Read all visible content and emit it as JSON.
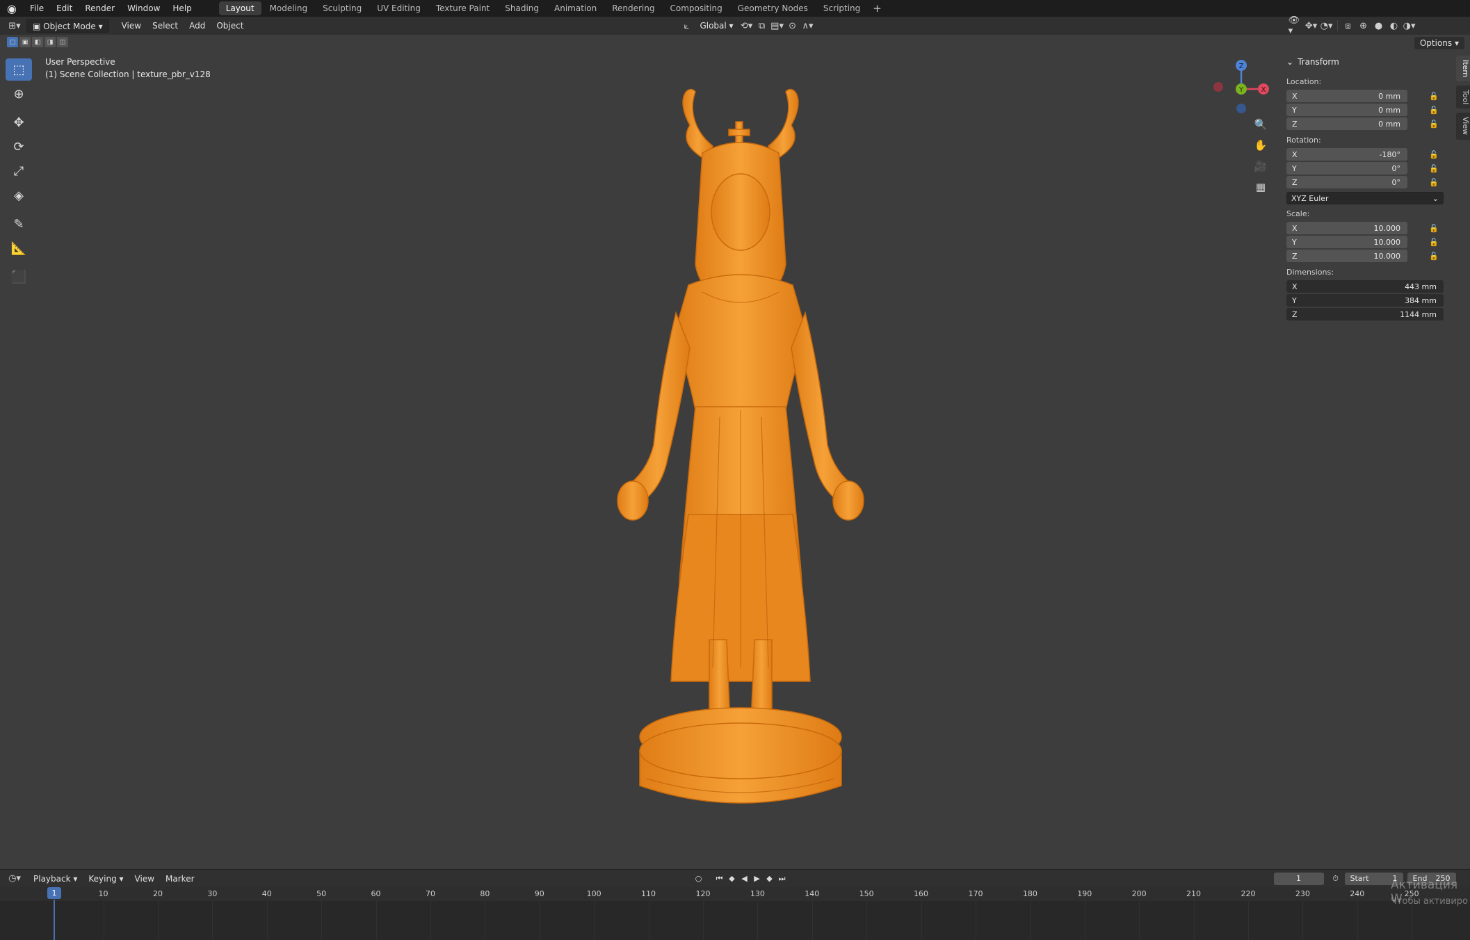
{
  "menubar": {
    "items": [
      "File",
      "Edit",
      "Render",
      "Window",
      "Help"
    ],
    "workspaces": [
      "Layout",
      "Modeling",
      "Sculpting",
      "UV Editing",
      "Texture Paint",
      "Shading",
      "Animation",
      "Rendering",
      "Compositing",
      "Geometry Nodes",
      "Scripting"
    ],
    "active_workspace": "Layout",
    "add_tab": "+"
  },
  "viewport_header": {
    "mode": "Object Mode",
    "menus": [
      "View",
      "Select",
      "Add",
      "Object"
    ],
    "orientation": "Global",
    "options": "Options"
  },
  "viewport": {
    "perspective": "User Perspective",
    "collection": "(1) Scene Collection | texture_pbr_v128",
    "gizmo_axes": {
      "z": "Z",
      "y": "Y",
      "x": "X"
    },
    "model_color": "#f0962a"
  },
  "transform": {
    "title": "Transform",
    "location_label": "Location:",
    "location": [
      {
        "axis": "X",
        "value": "0 mm"
      },
      {
        "axis": "Y",
        "value": "0 mm"
      },
      {
        "axis": "Z",
        "value": "0 mm"
      }
    ],
    "rotation_label": "Rotation:",
    "rotation": [
      {
        "axis": "X",
        "value": "-180°"
      },
      {
        "axis": "Y",
        "value": "0°"
      },
      {
        "axis": "Z",
        "value": "0°"
      }
    ],
    "rotation_mode": "XYZ Euler",
    "scale_label": "Scale:",
    "scale": [
      {
        "axis": "X",
        "value": "10.000"
      },
      {
        "axis": "Y",
        "value": "10.000"
      },
      {
        "axis": "Z",
        "value": "10.000"
      }
    ],
    "dimensions_label": "Dimensions:",
    "dimensions": [
      {
        "axis": "X",
        "value": "443 mm"
      },
      {
        "axis": "Y",
        "value": "384 mm"
      },
      {
        "axis": "Z",
        "value": "1144 mm"
      }
    ]
  },
  "side_tabs": [
    "Item",
    "Tool",
    "View"
  ],
  "timeline": {
    "menus": [
      "Playback",
      "Keying",
      "View",
      "Marker"
    ],
    "current_frame": "1",
    "start_label": "Start",
    "start": "1",
    "end_label": "End",
    "end": "250",
    "ruler": [
      "1",
      "10",
      "20",
      "30",
      "40",
      "50",
      "60",
      "70",
      "80",
      "90",
      "100",
      "110",
      "120",
      "130",
      "140",
      "150",
      "160",
      "170",
      "180",
      "190",
      "200",
      "210",
      "220",
      "230",
      "240",
      "250"
    ]
  },
  "watermark": {
    "line1": "Активация W",
    "line2": "Чтобы активиро"
  }
}
